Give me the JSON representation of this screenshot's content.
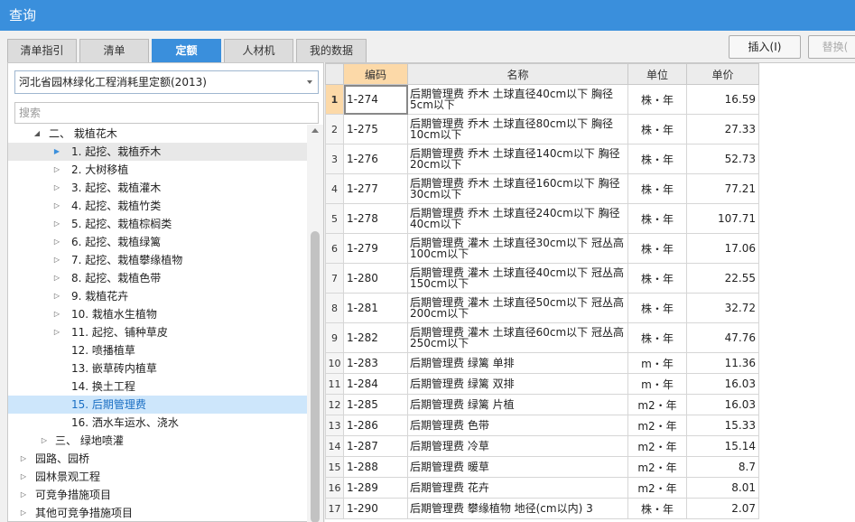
{
  "window": {
    "title": "查询"
  },
  "tabs": [
    {
      "label": "清单指引",
      "active": false
    },
    {
      "label": "清单",
      "active": false
    },
    {
      "label": "定额",
      "active": true
    },
    {
      "label": "人材机",
      "active": false
    },
    {
      "label": "我的数据",
      "active": false
    }
  ],
  "toolbar": {
    "insert_label": "插入(I)",
    "replace_label": "替换("
  },
  "library": {
    "selected": "河北省园林绿化工程消耗里定额(2013)"
  },
  "search": {
    "placeholder": "搜索",
    "value": ""
  },
  "tree": [
    {
      "label": "二、 栽植花木",
      "level": 1,
      "expanded": true
    },
    {
      "label": "1. 起挖、栽植乔木",
      "level": 2,
      "expanded": false,
      "state": "hover"
    },
    {
      "label": "2. 大树移植",
      "level": 2,
      "expanded": false
    },
    {
      "label": "3. 起挖、栽植灌木",
      "level": 2,
      "expanded": false
    },
    {
      "label": "4. 起挖、栽植竹类",
      "level": 2,
      "expanded": false
    },
    {
      "label": "5. 起挖、栽植棕榈类",
      "level": 2,
      "expanded": false
    },
    {
      "label": "6. 起挖、栽植绿篱",
      "level": 2,
      "expanded": false
    },
    {
      "label": "7. 起挖、栽植攀缘植物",
      "level": 2,
      "expanded": false
    },
    {
      "label": "8. 起挖、栽植色带",
      "level": 2,
      "expanded": false
    },
    {
      "label": "9. 栽植花卉",
      "level": 2,
      "expanded": false
    },
    {
      "label": "10. 栽植水生植物",
      "level": 2,
      "expanded": false
    },
    {
      "label": "11. 起挖、铺种草皮",
      "level": 2,
      "expanded": false
    },
    {
      "label": "12. 喷播植草",
      "level": 3
    },
    {
      "label": "13. 嵌草砖内植草",
      "level": 3
    },
    {
      "label": "14. 换土工程",
      "level": 3
    },
    {
      "label": "15. 后期管理费",
      "level": 3,
      "state": "selected"
    },
    {
      "label": "16. 洒水车运水、浇水",
      "level": 3
    },
    {
      "label": "三、 绿地喷灌",
      "level": 1,
      "expanded": false
    },
    {
      "label": "园路、园桥",
      "level": 0,
      "expanded": false
    },
    {
      "label": "园林景观工程",
      "level": 0,
      "expanded": false
    },
    {
      "label": "可竞争措施项目",
      "level": 0,
      "expanded": false
    },
    {
      "label": "其他可竞争措施项目",
      "level": 0,
      "expanded": false
    }
  ],
  "grid": {
    "columns": [
      "编码",
      "名称",
      "单位",
      "单价"
    ],
    "rows": [
      {
        "n": "1",
        "code": "1-274",
        "name1": "后期管理费 乔木 土球直径40cm以下 胸径",
        "name2": "5cm以下",
        "unit": "株・年",
        "price": "16.59"
      },
      {
        "n": "2",
        "code": "1-275",
        "name1": "后期管理费 乔木 土球直径80cm以下 胸径",
        "name2": "10cm以下",
        "unit": "株・年",
        "price": "27.33"
      },
      {
        "n": "3",
        "code": "1-276",
        "name1": "后期管理费 乔木 土球直径140cm以下 胸径",
        "name2": "20cm以下",
        "unit": "株・年",
        "price": "52.73"
      },
      {
        "n": "4",
        "code": "1-277",
        "name1": "后期管理费 乔木 土球直径160cm以下 胸径",
        "name2": "30cm以下",
        "unit": "株・年",
        "price": "77.21"
      },
      {
        "n": "5",
        "code": "1-278",
        "name1": "后期管理费 乔木 土球直径240cm以下 胸径",
        "name2": "40cm以下",
        "unit": "株・年",
        "price": "107.71"
      },
      {
        "n": "6",
        "code": "1-279",
        "name1": "后期管理费 灌木 土球直径30cm以下 冠丛高",
        "name2": "100cm以下",
        "unit": "株・年",
        "price": "17.06"
      },
      {
        "n": "7",
        "code": "1-280",
        "name1": "后期管理费 灌木 土球直径40cm以下 冠丛高",
        "name2": "150cm以下",
        "unit": "株・年",
        "price": "22.55"
      },
      {
        "n": "8",
        "code": "1-281",
        "name1": "后期管理费 灌木 土球直径50cm以下 冠丛高",
        "name2": "200cm以下",
        "unit": "株・年",
        "price": "32.72"
      },
      {
        "n": "9",
        "code": "1-282",
        "name1": "后期管理费 灌木 土球直径60cm以下 冠丛高",
        "name2": "250cm以下",
        "unit": "株・年",
        "price": "47.76"
      },
      {
        "n": "10",
        "code": "1-283",
        "name1": "后期管理费 绿篱 单排",
        "name2": "",
        "unit": "m・年",
        "price": "11.36"
      },
      {
        "n": "11",
        "code": "1-284",
        "name1": "后期管理费 绿篱 双排",
        "name2": "",
        "unit": "m・年",
        "price": "16.03"
      },
      {
        "n": "12",
        "code": "1-285",
        "name1": "后期管理费 绿篱 片植",
        "name2": "",
        "unit": "m2・年",
        "price": "16.03"
      },
      {
        "n": "13",
        "code": "1-286",
        "name1": "后期管理费 色带",
        "name2": "",
        "unit": "m2・年",
        "price": "15.33"
      },
      {
        "n": "14",
        "code": "1-287",
        "name1": "后期管理费 冷草",
        "name2": "",
        "unit": "m2・年",
        "price": "15.14"
      },
      {
        "n": "15",
        "code": "1-288",
        "name1": "后期管理费 暖草",
        "name2": "",
        "unit": "m2・年",
        "price": "8.7"
      },
      {
        "n": "16",
        "code": "1-289",
        "name1": "后期管理费 花卉",
        "name2": "",
        "unit": "m2・年",
        "price": "8.01"
      },
      {
        "n": "17",
        "code": "1-290",
        "name1": "后期管理费 攀缘植物 地径(cm以内) 3",
        "name2": "",
        "unit": "株・年",
        "price": "2.07"
      }
    ]
  },
  "colors": {
    "accent": "#3a8fdc",
    "header_highlight": "#fcd9a8",
    "selection": "#cde6fb"
  }
}
